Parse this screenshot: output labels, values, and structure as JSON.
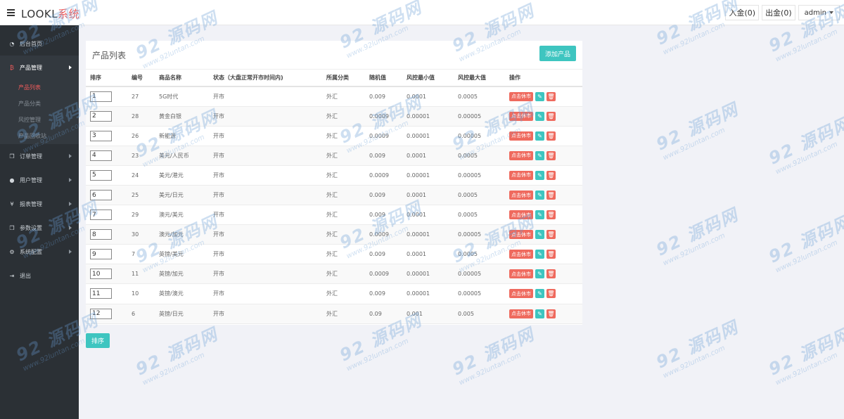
{
  "header": {
    "logo_main": "LOOKL",
    "logo_accent": "系统",
    "deposit": "入金(0)",
    "withdraw": "出金(0)",
    "user": "admin"
  },
  "sidebar": {
    "items": [
      {
        "label": "后台首页",
        "icon": "tachometer-icon"
      },
      {
        "label": "产品管理",
        "icon": "bitcoin-icon"
      },
      {
        "label": "订单管理",
        "icon": "copy-icon"
      },
      {
        "label": "用户管理",
        "icon": "user-icon"
      },
      {
        "label": "报表管理",
        "icon": "yen-icon"
      },
      {
        "label": "参数设置",
        "icon": "copy-icon"
      },
      {
        "label": "系统配置",
        "icon": "cogs-icon"
      },
      {
        "label": "退出",
        "icon": "sign-out-icon"
      }
    ],
    "sub_items": [
      "产品列表",
      "产品分类",
      "风控管理",
      "产品回收站"
    ]
  },
  "panel": {
    "title": "产品列表",
    "add_label": "添加产品"
  },
  "table": {
    "headers": [
      "排序",
      "编号",
      "商品名称",
      "状态（大盘正常开市时间内)",
      "所属分类",
      "随机值",
      "风控最小值",
      "风控最大值",
      "操作"
    ],
    "close_label": "点击休市",
    "rows": [
      [
        "1",
        "27",
        "5G时代",
        "开市",
        "外汇",
        "0.009",
        "0.0001",
        "0.0005"
      ],
      [
        "2",
        "28",
        "黄金白银",
        "开市",
        "外汇",
        "0.0009",
        "0.00001",
        "0.00005"
      ],
      [
        "3",
        "26",
        "新能源",
        "开市",
        "外汇",
        "0.0009",
        "0.00001",
        "0.00005"
      ],
      [
        "4",
        "23",
        "美元/人民币",
        "开市",
        "外汇",
        "0.009",
        "0.0001",
        "0.0005"
      ],
      [
        "5",
        "24",
        "美元/港元",
        "开市",
        "外汇",
        "0.0009",
        "0.00001",
        "0.00005"
      ],
      [
        "6",
        "25",
        "美元/日元",
        "开市",
        "外汇",
        "0.009",
        "0.0001",
        "0.0005"
      ],
      [
        "7",
        "29",
        "澳元/美元",
        "开市",
        "外汇",
        "0.009",
        "0.0001",
        "0.0005"
      ],
      [
        "8",
        "30",
        "澳元/加元",
        "开市",
        "外汇",
        "0.0009",
        "0.00001",
        "0.00005"
      ],
      [
        "9",
        "7",
        "英镑/美元",
        "开市",
        "外汇",
        "0.009",
        "0.0001",
        "0.0005"
      ],
      [
        "10",
        "11",
        "英镑/加元",
        "开市",
        "外汇",
        "0.0009",
        "0.00001",
        "0.00005"
      ],
      [
        "11",
        "10",
        "英镑/澳元",
        "开市",
        "外汇",
        "0.009",
        "0.00001",
        "0.00005"
      ],
      [
        "12",
        "6",
        "英镑/日元",
        "开市",
        "外汇",
        "0.09",
        "0.001",
        "0.005"
      ]
    ]
  },
  "sort_button": "排序",
  "watermark": {
    "big": "92 源码网",
    "small": "www.92luntan.com"
  },
  "colors": {
    "accent_teal": "#3ec5c0",
    "accent_red": "#ef6a5e",
    "sidebar_bg": "#2b3035"
  }
}
